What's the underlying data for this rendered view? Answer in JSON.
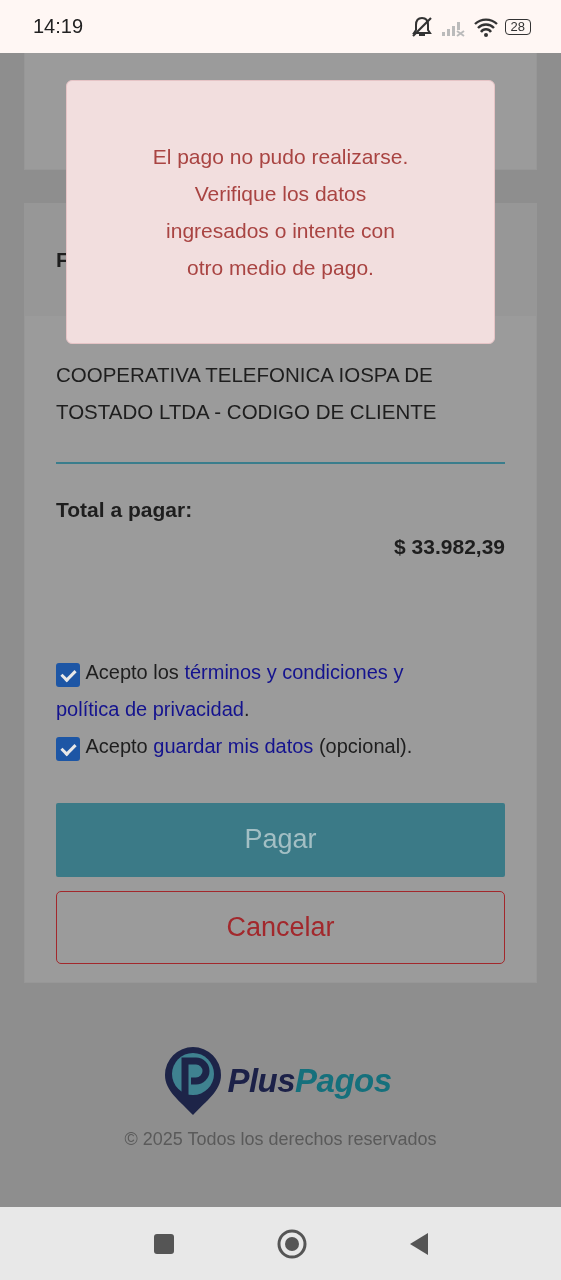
{
  "status_bar": {
    "time": "14:19",
    "battery": "28"
  },
  "card_heading": "F",
  "alert": {
    "lines": [
      "El pago no pudo realizarse.",
      "Verifique los datos",
      "ingresados o intente con",
      "otro medio de pago."
    ]
  },
  "merchant": "COOPERATIVA TELEFONICA IOSPA DE TOSTADO LTDA - CODIGO DE CLIENTE",
  "total": {
    "label": "Total a pagar:",
    "amount": "$ 33.982,39"
  },
  "consents": [
    {
      "checked": true,
      "segments": [
        {
          "kind": "text",
          "text": "Acepto los"
        },
        {
          "kind": "link",
          "text": "términos y condiciones y"
        },
        {
          "kind": "link",
          "text": "política de privacidad"
        },
        {
          "kind": "text",
          "text": "."
        }
      ]
    },
    {
      "checked": true,
      "segments": [
        {
          "kind": "text",
          "text": "Acepto"
        },
        {
          "kind": "link",
          "text": "guardar mis datos"
        },
        {
          "kind": "text",
          "text": "(opcional)."
        }
      ]
    }
  ],
  "buttons": [
    {
      "kind": "primary",
      "label": "Pagar"
    },
    {
      "kind": "outline",
      "label": "Cancelar"
    }
  ],
  "footer": {
    "logo_first": "Plus",
    "logo_second": "Pagos",
    "copyright": "© 2025 Todos los derechos reservados"
  }
}
